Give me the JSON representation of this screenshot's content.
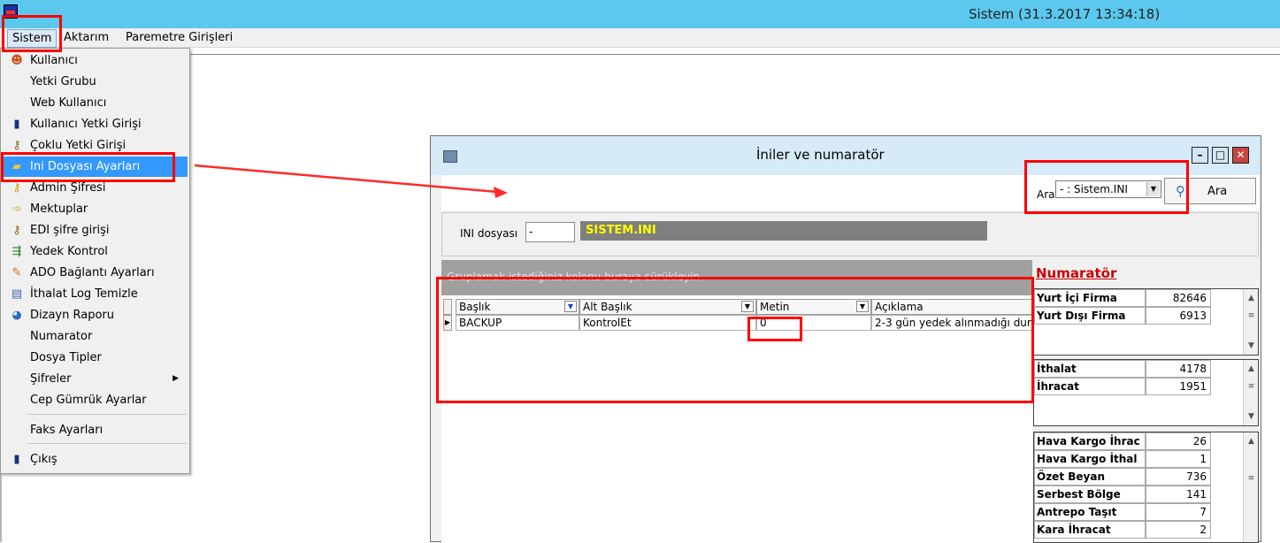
{
  "main_window": {
    "title": "Sistem (31.3.2017 13:34:18)"
  },
  "menubar": {
    "items": [
      "Sistem",
      "Aktarım",
      "Paremetre Girişleri"
    ]
  },
  "dropdown": {
    "items": [
      {
        "label": "Kullanıcı",
        "icon": "user-icon"
      },
      {
        "label": "Yetki Grubu",
        "icon": ""
      },
      {
        "label": "Web Kullanıcı",
        "icon": ""
      },
      {
        "label": "Kullanıcı Yetki Girişi",
        "icon": "door-icon"
      },
      {
        "label": "Çoklu Yetki Girişi",
        "icon": "keys-icon"
      },
      {
        "label": "Ini Dosyası Ayarları",
        "icon": "folder-icon"
      },
      {
        "label": "Admin Şifresi",
        "icon": "key-icon"
      },
      {
        "label": "Mektuplar",
        "icon": "mail-icon"
      },
      {
        "label": "EDI şifre girişi",
        "icon": "keys-icon"
      },
      {
        "label": "Yedek Kontrol",
        "icon": "backup-icon"
      },
      {
        "label": "ADO Bağlantı Ayarları",
        "icon": "connection-icon"
      },
      {
        "label": "İthalat Log Temizle",
        "icon": "clean-icon"
      },
      {
        "label": "Dizayn Raporu",
        "icon": "report-icon"
      },
      {
        "label": "Numarator",
        "icon": ""
      },
      {
        "label": "Dosya Tipler",
        "icon": ""
      },
      {
        "label": "Şifreler",
        "icon": ""
      },
      {
        "label": "Cep Gümrük Ayarlar",
        "icon": ""
      },
      {
        "label": "Faks Ayarları",
        "icon": ""
      },
      {
        "label": "Çıkış",
        "icon": "door-icon"
      }
    ]
  },
  "child_window": {
    "title": "İniler ve numaratör",
    "search": {
      "label": "Ara",
      "selected": "- : Sistem.INI",
      "button_label": "Ara"
    },
    "ini": {
      "label": "INI dosyası",
      "value": "-",
      "name": "SISTEM.INI"
    },
    "grid": {
      "group_hint": "Gruplamak istediğiniz kolonu buraya sürükleyin",
      "columns": [
        "Başlık",
        "Alt Başlık",
        "Metin",
        "Açıklama"
      ],
      "rows": [
        [
          "BACKUP",
          "KontrolEt",
          "0",
          "2-3 gün yedek alınmadığı duru"
        ]
      ]
    },
    "numarator": {
      "title": "Numaratör",
      "groups": [
        [
          {
            "k": "Yurt İçi Firma",
            "v": "82646"
          },
          {
            "k": "Yurt Dışı Firma",
            "v": "6913"
          }
        ],
        [
          {
            "k": "İthalat",
            "v": "4178"
          },
          {
            "k": "İhracat",
            "v": "1951"
          }
        ],
        [
          {
            "k": "Hava Kargo İhrac",
            "v": "26"
          },
          {
            "k": "Hava Kargo İthal",
            "v": "1"
          },
          {
            "k": "Özet Beyan",
            "v": "736"
          },
          {
            "k": "Serbest Bölge",
            "v": "141"
          },
          {
            "k": "Antrepo Taşıt",
            "v": "7"
          },
          {
            "k": "Kara İhracat",
            "v": "2"
          }
        ]
      ]
    }
  },
  "colors": {
    "titlebar": "#5cc8ee",
    "highlight": "#3399ff",
    "annotation": "#ff0000",
    "numarator_title": "#cc0000",
    "ini_name_text": "#ffff00"
  }
}
